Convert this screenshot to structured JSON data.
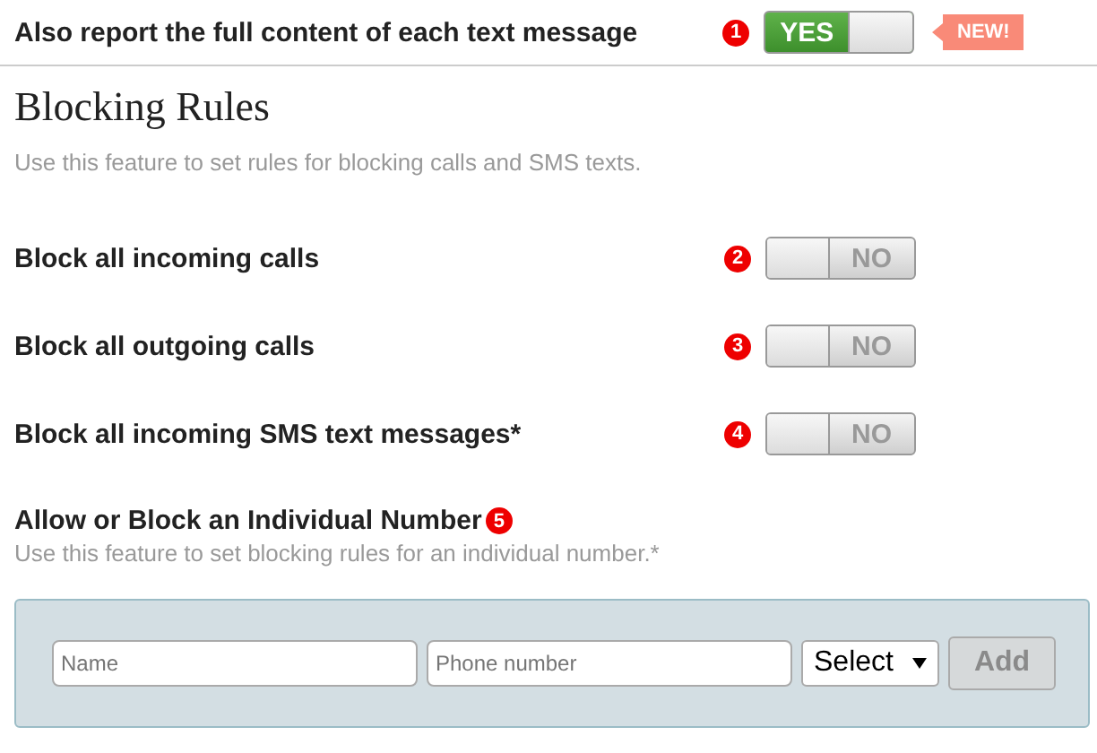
{
  "top_setting": {
    "label": "Also report the full content of each text message",
    "badge": "1",
    "toggle": {
      "on": true,
      "text": "YES"
    },
    "tag": "NEW!"
  },
  "section": {
    "title": "Blocking Rules",
    "description": "Use this feature to set rules for blocking calls and SMS texts."
  },
  "rules": [
    {
      "label": "Block all incoming calls",
      "badge": "2",
      "toggle": {
        "on": false,
        "text": "NO"
      }
    },
    {
      "label": "Block all outgoing calls",
      "badge": "3",
      "toggle": {
        "on": false,
        "text": "NO"
      }
    },
    {
      "label": "Block all incoming SMS text messages*",
      "badge": "4",
      "toggle": {
        "on": false,
        "text": "NO"
      }
    }
  ],
  "individual": {
    "title": "Allow or Block an Individual Number",
    "badge": "5",
    "description": "Use this feature to set blocking rules for an individual number.*",
    "name_field": {
      "placeholder": "Name"
    },
    "phone_field": {
      "placeholder": "Phone number"
    },
    "select": {
      "value": "Select"
    },
    "add_button": {
      "label": "Add",
      "disabled": true
    }
  }
}
